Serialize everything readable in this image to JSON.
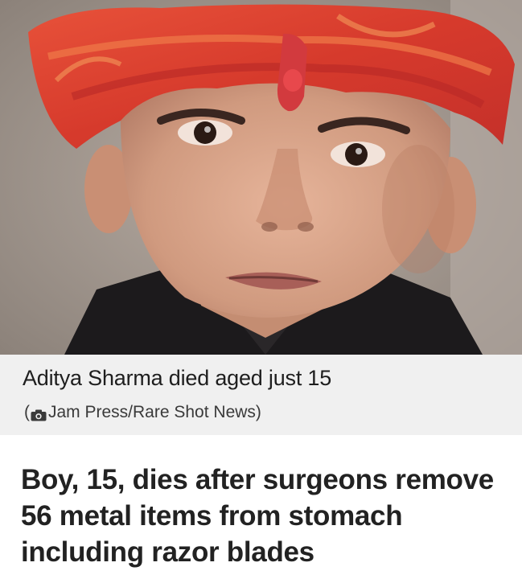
{
  "article": {
    "caption": "Aditya Sharma died aged just 15",
    "credit_open": "(",
    "credit_text": "Jam Press/Rare Shot News)",
    "headline": "Boy, 15, dies after surgeons remove 56 metal items from stomach including razor blades"
  },
  "icons": {
    "credit": "camera-icon"
  },
  "colors": {
    "caption_background": "#f0f0f0",
    "headline_text": "#222222",
    "turban": "#d9442e"
  }
}
